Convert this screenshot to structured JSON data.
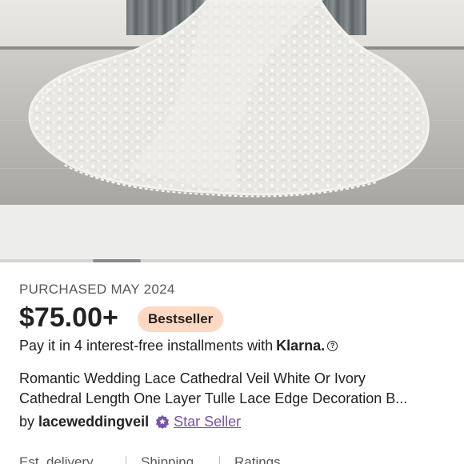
{
  "gallery": {
    "image_alt": "Romantic Wedding Lace Cathedral Veil spread on floor",
    "scroll_position": 0.2
  },
  "product": {
    "purchased_label": "PURCHASED MAY 2024",
    "price": "$75.00+",
    "badge": "Bestseller",
    "installments_text": "Pay it in 4 interest-free installments with",
    "installments_brand": "Klarna.",
    "installments_help_icon": "help-circle-icon",
    "title_line1": "Romantic Wedding Lace Cathedral Veil White Or Ivory",
    "title_line2": "Cathedral Length One Layer Tulle Lace Edge Decoration B...",
    "seller_prefix": "by",
    "seller_name": "laceweddingveil",
    "star_seller_label": "Star Seller",
    "star_seller_icon": "star-seller-badge-icon"
  },
  "stats": {
    "items": [
      "Est. delivery",
      "Shipping",
      "Ratings"
    ]
  },
  "colors": {
    "badge_bg": "#fdd9c2",
    "star_seller": "#7851a9",
    "muted_text": "#595959",
    "text": "#222222"
  }
}
